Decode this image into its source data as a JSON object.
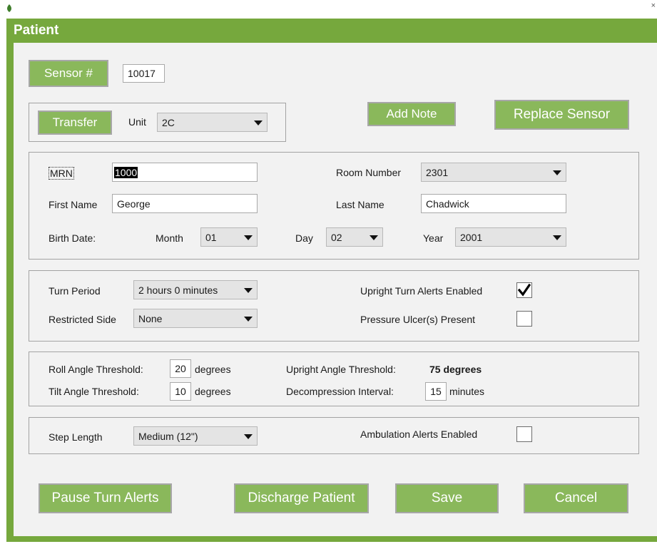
{
  "window": {
    "title": "Patient"
  },
  "icons": {
    "app": "leaf-icon",
    "close": "close-icon",
    "check": "checkmark-icon",
    "dropdown": "dropdown-arrow-icon"
  },
  "colors": {
    "accent": "#76a83d",
    "button": "#8ab85b"
  },
  "sensor": {
    "button_label": "Sensor #",
    "value": "10017"
  },
  "transfer": {
    "button_label": "Transfer",
    "unit_label": "Unit",
    "unit_value": "2C"
  },
  "actions": {
    "add_note": "Add Note",
    "replace_sensor": "Replace Sensor"
  },
  "patient": {
    "mrn_label": "MRN",
    "mrn_value": "1000",
    "room_label": "Room Number",
    "room_value": "2301",
    "first_name_label": "First Name",
    "first_name_value": "George",
    "last_name_label": "Last Name",
    "last_name_value": "Chadwick",
    "birth_label": "Birth Date:",
    "month_label": "Month",
    "month_value": "01",
    "day_label": "Day",
    "day_value": "02",
    "year_label": "Year",
    "year_value": "2001"
  },
  "turn": {
    "period_label": "Turn Period",
    "period_value": "2 hours 0 minutes",
    "restricted_label": "Restricted Side",
    "restricted_value": "None",
    "upright_alerts_label": "Upright Turn Alerts Enabled",
    "upright_alerts_checked": true,
    "ulcer_label": "Pressure Ulcer(s) Present",
    "ulcer_checked": false
  },
  "thresholds": {
    "roll_label": "Roll Angle Threshold:",
    "roll_value": "20",
    "roll_unit": "degrees",
    "tilt_label": "Tilt Angle Threshold:",
    "tilt_value": "10",
    "tilt_unit": "degrees",
    "upright_label": "Upright Angle Threshold:",
    "upright_value": "75 degrees",
    "decomp_label": "Decompression Interval:",
    "decomp_value": "15",
    "decomp_unit": "minutes"
  },
  "ambulation": {
    "step_label": "Step Length",
    "step_value": "Medium (12\")",
    "alerts_label": "Ambulation Alerts Enabled",
    "alerts_checked": false
  },
  "footer": {
    "pause": "Pause Turn Alerts",
    "discharge": "Discharge Patient",
    "save": "Save",
    "cancel": "Cancel"
  }
}
